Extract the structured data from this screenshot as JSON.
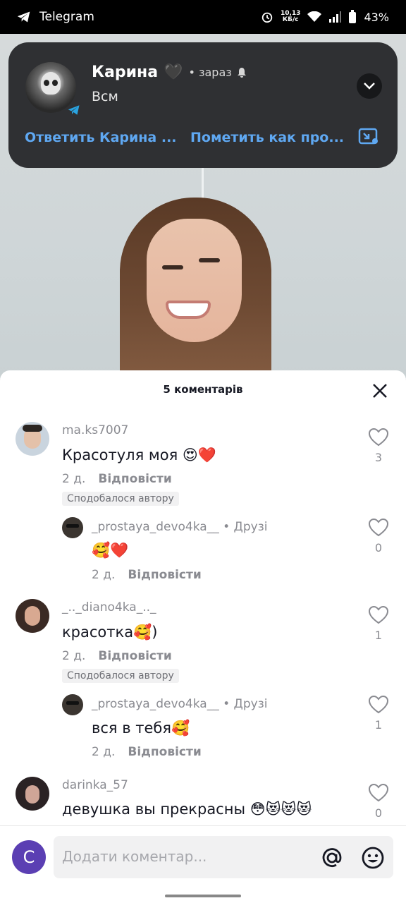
{
  "status_bar": {
    "app_name": "Telegram",
    "net_speed_value": "10,13",
    "net_speed_unit": "КБ/с",
    "battery": "43%"
  },
  "notification": {
    "sender": "Карина",
    "sender_emoji": "🖤",
    "time": "• зараз",
    "message": "Всм",
    "action_reply": "Ответить Карина ...",
    "action_mark": "Пометить как про..."
  },
  "comments_sheet": {
    "title": "5 коментарів",
    "comments": [
      {
        "user": "ma.ks7007",
        "text": "Красотуля моя 😍❤️",
        "age": "2 д.",
        "reply_label": "Відповісти",
        "likes": "3",
        "badge": "Сподобалося автору"
      },
      {
        "user": "_prostaya_devo4ka__",
        "friend": "• Друзі",
        "text": "🥰❤️",
        "age": "2 д.",
        "reply_label": "Відповісти",
        "likes": "0"
      },
      {
        "user": "_.._diano4ka_.._",
        "text": "красотка🥰)",
        "age": "2 д.",
        "reply_label": "Відповісти",
        "likes": "1",
        "badge": "Сподобалося автору"
      },
      {
        "user": "_prostaya_devo4ka__",
        "friend": "• Друзі",
        "text": "вся в тебя🥰",
        "age": "2 д.",
        "reply_label": "Відповісти",
        "likes": "1"
      },
      {
        "user": "darinka_57",
        "text": "девушка вы прекрасны 😳😻😻😻",
        "likes": "0"
      }
    ]
  },
  "input_bar": {
    "avatar_letter": "C",
    "placeholder": "Додати коментар..."
  },
  "colors": {
    "link_blue": "#5fa8f2",
    "notif_bg": "#2f3033",
    "avatar_purple": "#5b3fb3"
  },
  "icons": [
    "telegram-icon",
    "alarm-icon",
    "wifi-icon",
    "signal-icon",
    "battery-icon",
    "bell-icon",
    "chevron-down-icon",
    "pip-icon",
    "close-icon",
    "heart-outline-icon",
    "at-icon",
    "emoji-icon"
  ]
}
